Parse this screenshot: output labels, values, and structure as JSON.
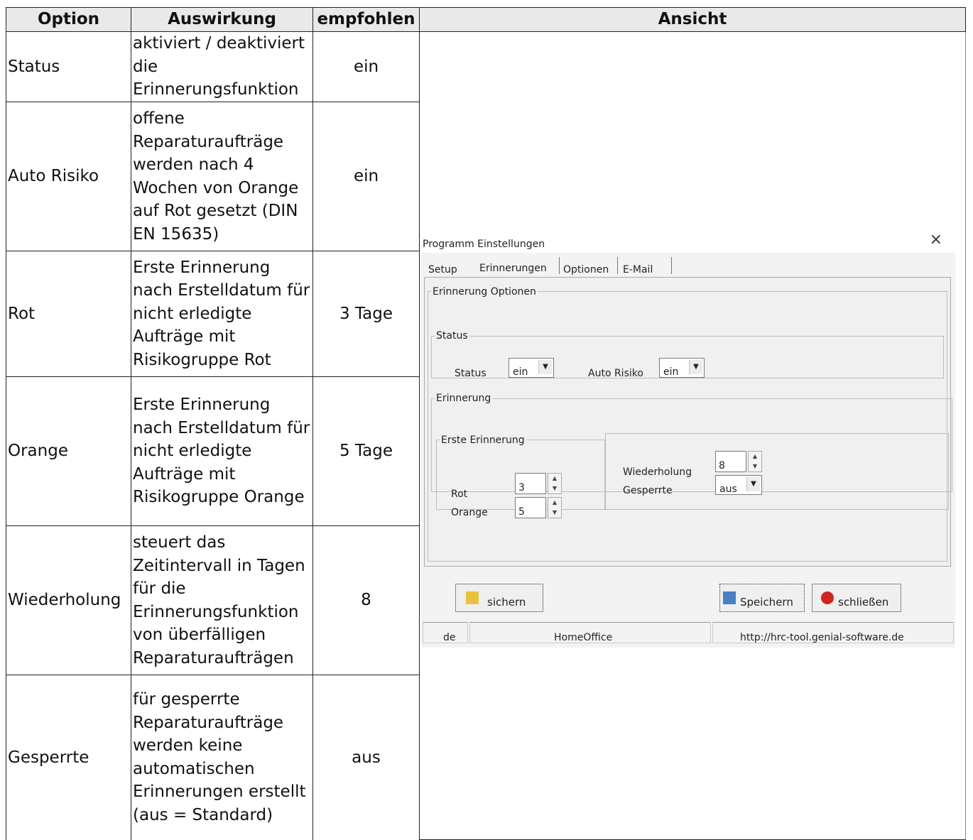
{
  "table": {
    "headers": [
      "Option",
      "Auswirkung",
      "empfohlen",
      "Ansicht"
    ],
    "rows": [
      {
        "option": "Status",
        "auswirkung": "aktiviert / deaktiviert die Erinnerungsfunktion",
        "empfohlen": "ein"
      },
      {
        "option": "Auto Risiko",
        "auswirkung": "offene Reparaturaufträge werden nach 4 Wochen von Orange auf Rot gesetzt (DIN EN 15635)",
        "empfohlen": "ein"
      },
      {
        "option": "Rot",
        "auswirkung": "Erste Erinnerung nach Erstelldatum für nicht erledigte Aufträge mit Risikogruppe Rot",
        "empfohlen": "3 Tage"
      },
      {
        "option": "Orange",
        "auswirkung": "Erste Erinnerung nach Erstelldatum für nicht erledigte Aufträge mit Risikogruppe Orange",
        "empfohlen": "5 Tage"
      },
      {
        "option": "Wiederholung",
        "auswirkung": "steuert das Zeitintervall in Tagen für die Erinnerungsfunktion von überfälligen Reparaturaufträgen",
        "empfohlen": "8"
      },
      {
        "option": "Gesperrte",
        "auswirkung": "für gesperrte Reparaturaufträge werden keine automatischen Erinnerungen erstellt (aus = Standard)",
        "empfohlen": "aus"
      }
    ]
  },
  "dialog": {
    "title": "Programm Einstellungen",
    "close_glyph": "×",
    "tabs": [
      "Setup",
      "Erinnerungen",
      "Optionen",
      "E-Mail"
    ],
    "active_tab": "Erinnerungen",
    "group_main": "Erinnerung Optionen",
    "group_status": "Status",
    "status_label": "Status",
    "status_value": "ein",
    "auto_risiko_label": "Auto Risiko",
    "auto_risiko_value": "ein",
    "group_erinnerung": "Erinnerung",
    "group_erste": "Erste Erinnerung",
    "rot_label": "Rot",
    "rot_value": "3",
    "orange_label": "Orange",
    "orange_value": "5",
    "wiederholung_label": "Wiederholung",
    "wiederholung_value": "8",
    "gesperrte_label": "Gesperrte",
    "gesperrte_value": "aus",
    "combo_arrow": "▼",
    "spin_up": "▲",
    "spin_down": "▼",
    "buttons": {
      "sichern": "sichern",
      "speichern": "Speichern",
      "schliessen": "schließen"
    },
    "statusbar": {
      "language": "de",
      "profile": "HomeOffice",
      "url": "http://hrc-tool.genial-software.de"
    },
    "colors": {
      "sichern_icon": "#e8c23a",
      "speichern_icon": "#4a7fc1",
      "schliessen_icon": "#d32222"
    }
  }
}
